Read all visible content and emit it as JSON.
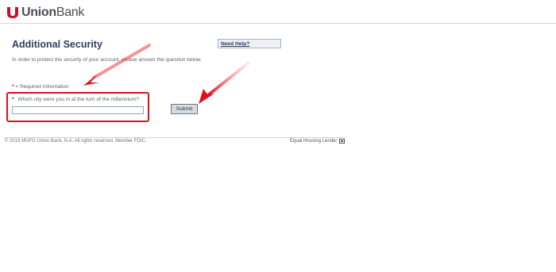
{
  "header": {
    "brand_bold": "Union",
    "brand_light": "Bank",
    "logo_icon": "union-bank-logo-icon",
    "brand_color": "#c8102e"
  },
  "main": {
    "title": "Additional Security",
    "intro": "In order to protect the security of your account, please answer the question below.",
    "help_label": "Need Help?",
    "required_star": "*",
    "required_label": "= Required Information",
    "question_star": "*",
    "question": "Which city were you in at the turn of the millennium?",
    "answer_value": "",
    "submit_label": "Submit"
  },
  "footer": {
    "copyright": "© 2019 MUFG Union Bank, N.A. All rights reserved. Member FDIC.",
    "equal_housing": "Equal Housing Lender",
    "equal_housing_icon": "equal-housing-icon"
  },
  "annotations": {
    "highlight_color": "#e0101e"
  }
}
